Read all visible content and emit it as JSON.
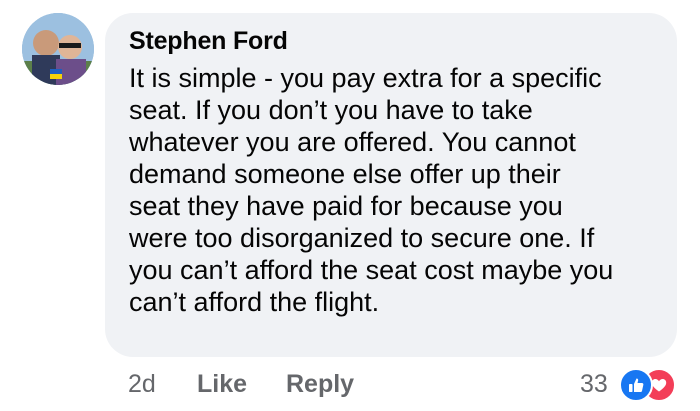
{
  "comment": {
    "author": "Stephen Ford",
    "text_lines": [
      "It is simple - you pay extra for a specific",
      "seat. If you don’t you have to take",
      "whatever you are offered. You cannot",
      "demand someone else offer up their",
      "seat they have paid for because you",
      "were too disorganized to secure one. If",
      "you can’t afford the seat cost maybe you",
      "can’t afford the flight."
    ],
    "time": "2d",
    "like_label": "Like",
    "reply_label": "Reply",
    "reaction_count": "33",
    "reaction_icons": [
      "thumbs-up-icon",
      "heart-icon"
    ]
  },
  "colors": {
    "bubble": "#f0f2f5",
    "meta_text": "#65676b",
    "like_blue": "#1877f2",
    "love_red": "#f33e58"
  }
}
